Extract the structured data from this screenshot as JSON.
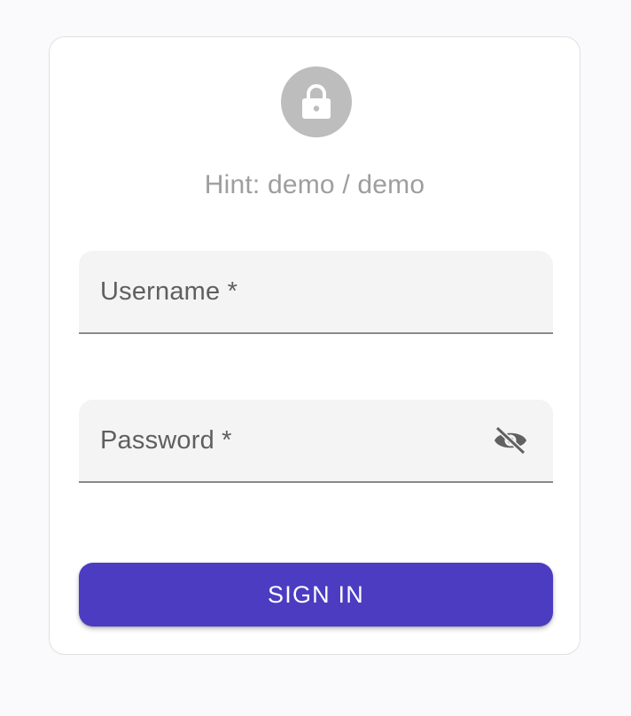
{
  "login": {
    "hint": "Hint: demo / demo",
    "lock_icon": "lock-icon",
    "username": {
      "label": "Username *",
      "value": ""
    },
    "password": {
      "label": "Password *",
      "value": "",
      "toggle_icon": "eye-off-icon"
    },
    "submit_label": "SIGN IN"
  },
  "colors": {
    "background": "#fafafd",
    "avatar": "#bdbdbd",
    "hint_text": "#9e9e9e",
    "field_fill": "#f4f4f4",
    "primary": "#4b3cc1"
  }
}
